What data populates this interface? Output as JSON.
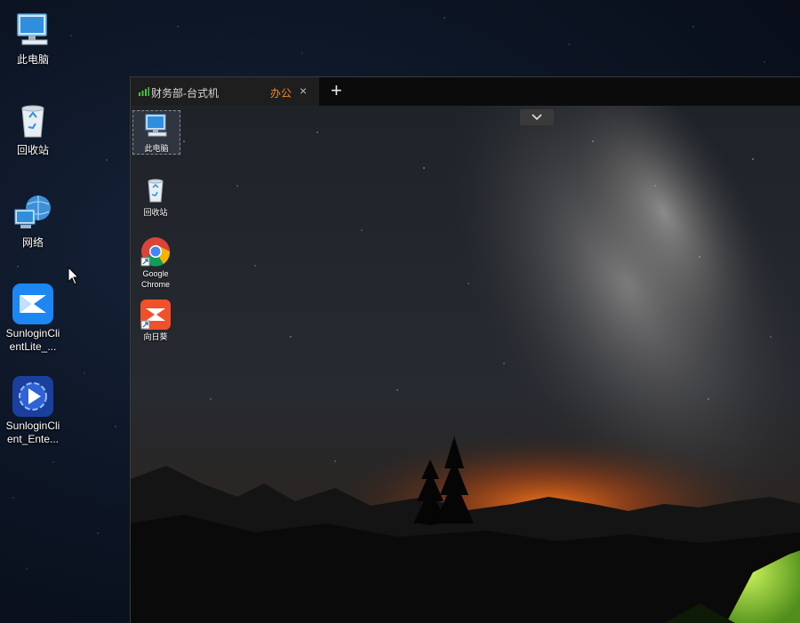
{
  "desktop": {
    "icons": [
      {
        "label": "此电脑",
        "icon": "computer-icon"
      },
      {
        "label": "回收站",
        "icon": "recycle-bin-icon"
      },
      {
        "label": "网络",
        "icon": "network-icon"
      },
      {
        "label": "SunloginClientLite_...",
        "icon": "sunlogin-lite-icon"
      },
      {
        "label": "SunloginClient_Ente...",
        "icon": "sunlogin-enterprise-icon"
      }
    ]
  },
  "remote_window": {
    "tab": {
      "device_name": "财务部-台式机",
      "group_name": "办公",
      "close_glyph": "×"
    },
    "add_tab_glyph": "+",
    "collapse_glyph": "chevron-down-icon",
    "accent_color": "#f08c2a",
    "signal_color": "#3cc93c",
    "remote_icons": [
      {
        "label": "此电脑",
        "icon": "computer-icon",
        "selected": true
      },
      {
        "label": "回收站",
        "icon": "recycle-bin-icon"
      },
      {
        "label": "Google Chrome",
        "icon": "chrome-icon",
        "shortcut": true
      },
      {
        "label": "向日葵",
        "icon": "sunlogin-icon",
        "shortcut": true
      }
    ]
  }
}
